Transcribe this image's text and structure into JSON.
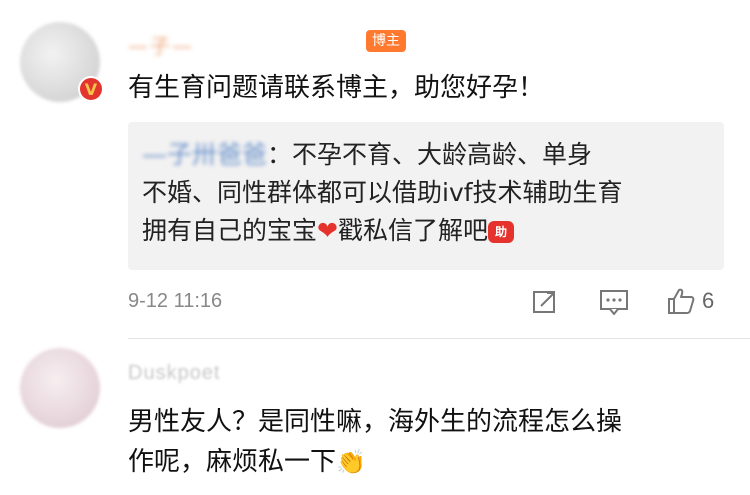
{
  "comments": [
    {
      "author": "—子—",
      "tag": "博主",
      "text": "有生育问题请联系博主，助您好孕！",
      "reply": {
        "author": "—子卅爸爸",
        "line1": "不孕不育、大龄高龄、单身",
        "line2": "不婚、同性群体都可以借助ivf技术辅助生育",
        "line3a": "拥有自己的宝宝",
        "line3b": "戳私信了解吧",
        "sticker": "助"
      },
      "time": "9-12 11:16",
      "likes": "6"
    },
    {
      "author": "Duskpoet",
      "text_line1": "男性友人？是同性嘛，海外生的流程怎么操",
      "text_line2": "作呢，麻烦私一下"
    }
  ],
  "icons": {
    "verified": "V",
    "heart": "❤",
    "clap": "👏"
  },
  "colors": {
    "tag": "#ff7a2e",
    "verified": "#e3352e",
    "reply_bg": "#f2f2f2"
  }
}
